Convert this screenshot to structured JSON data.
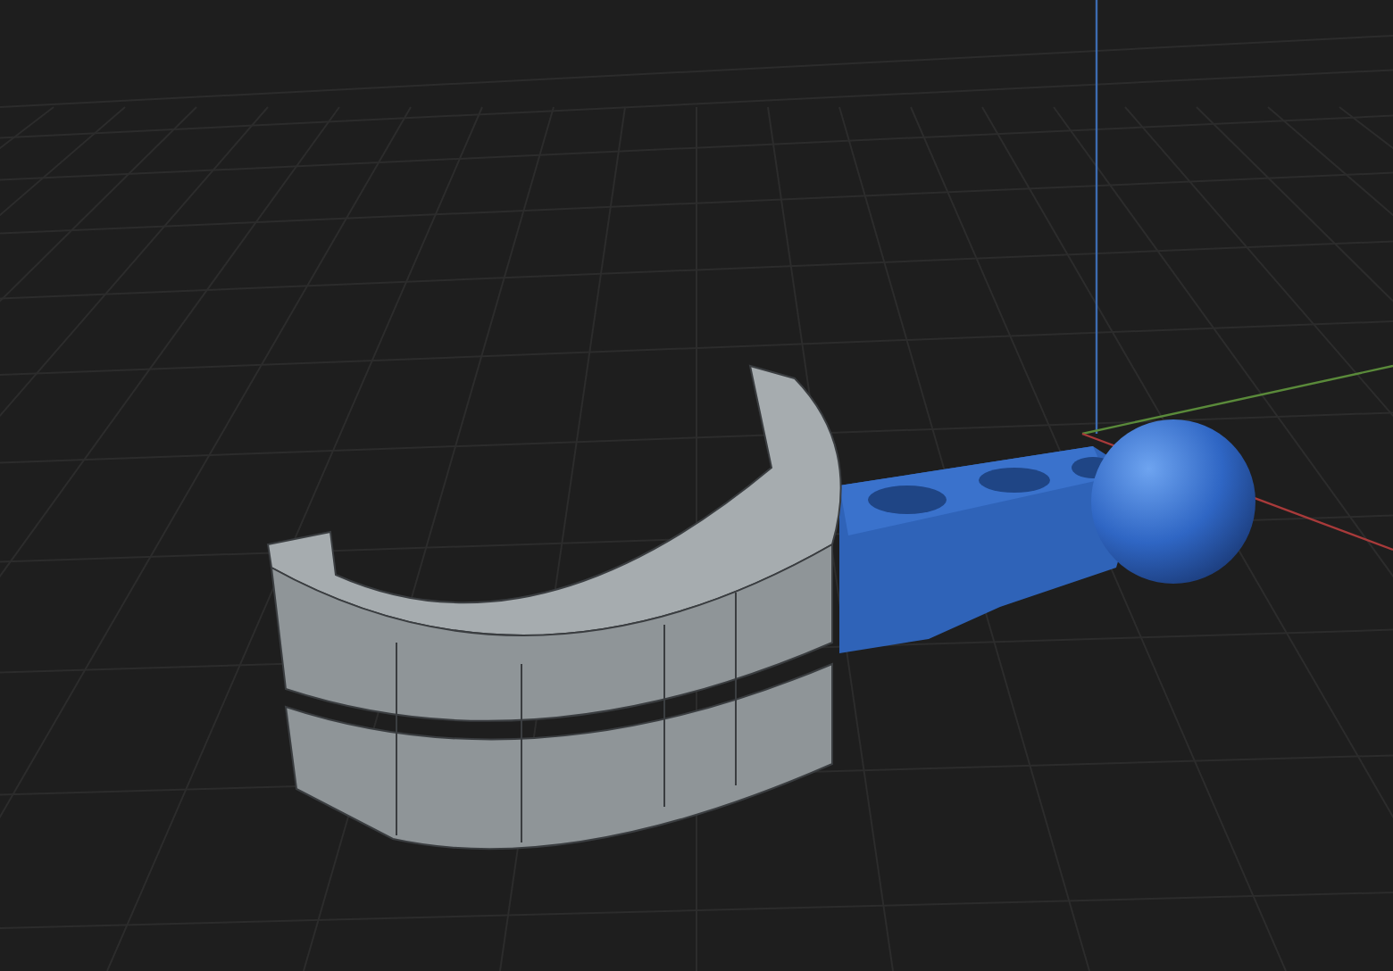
{
  "viewport": {
    "axes": [
      {
        "kind": "z"
      },
      {
        "kind": "y"
      },
      {
        "kind": "x"
      }
    ],
    "objects": [
      {
        "kind": "handle"
      },
      {
        "kind": "sphere"
      },
      {
        "kind": "bracket"
      }
    ]
  }
}
